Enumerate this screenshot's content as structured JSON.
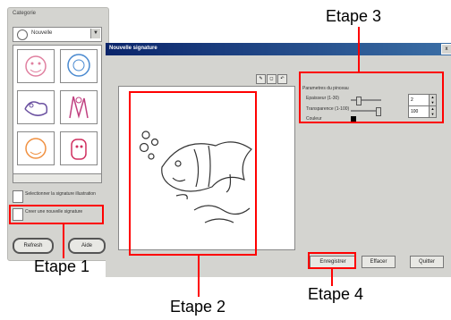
{
  "left_panel": {
    "category_label": "Categorie",
    "category_value": "Nouvelle",
    "options": [
      {
        "label": "Selectionner la signature illustration"
      },
      {
        "label": "Creer une nouvelle signature"
      }
    ],
    "refresh_label": "Refresh",
    "help_label": "Aide"
  },
  "window": {
    "title": "Nouvelle signature",
    "close_label": "x",
    "settings_title": "Parametres du pinceau",
    "settings": [
      {
        "label": "Epaisseur (1-30)",
        "value": "2"
      },
      {
        "label": "Transparence (1-100)",
        "value": "100"
      },
      {
        "label": "Couleur"
      }
    ],
    "color": "#000000",
    "buttons": {
      "save": "Enregistrer",
      "clear": "Effacer",
      "cancel": "Quitter"
    }
  },
  "annotations": {
    "step1": "Etape 1",
    "step2": "Etape 2",
    "step3": "Etape 3",
    "step4": "Etape 4"
  },
  "colors": {
    "annotation": "#ff0000",
    "titlebar": "#0a246a"
  }
}
